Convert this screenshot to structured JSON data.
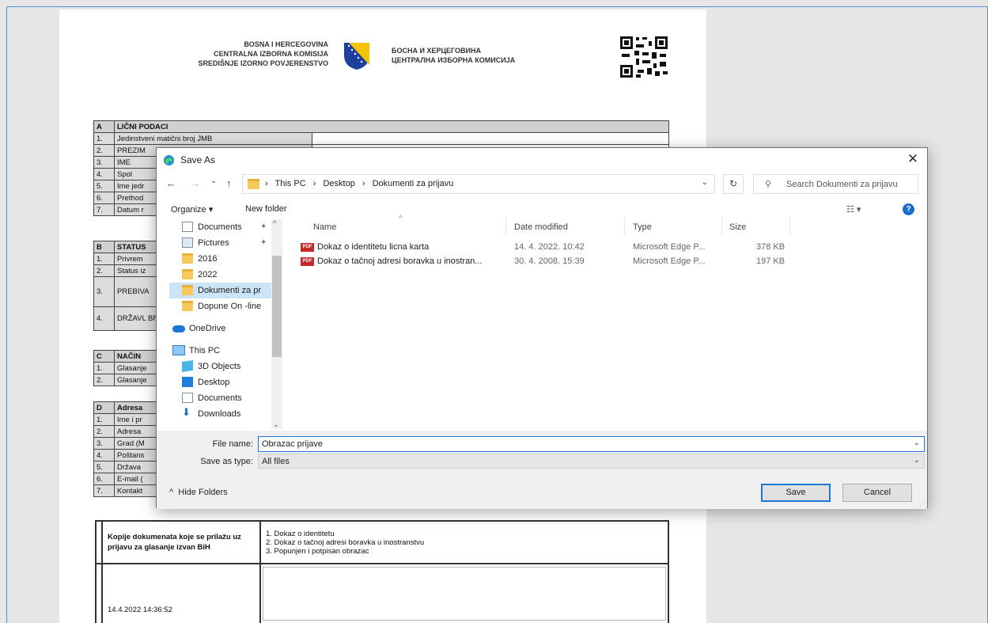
{
  "document": {
    "header_left": [
      "BOSNA I HERCEGOVINA",
      "CENTRALNA IZBORNA KOMISIJA",
      "SREDIŠNJE IZORNO POVJERENSTVO"
    ],
    "header_right": [
      "БОСНА И ХЕРЦЕГОВИНА",
      "ЦЕНТРАЛНА ИЗБОРНА КОМИСИЈА"
    ],
    "section_a": {
      "letter": "A",
      "title": "LIČNI PODACI",
      "rows": [
        {
          "n": "1.",
          "label": "Jedinstveni matični broj JMB"
        },
        {
          "n": "2.",
          "label": "PREZIM"
        },
        {
          "n": "3.",
          "label": "IME"
        },
        {
          "n": "4.",
          "label": "Spol"
        },
        {
          "n": "5.",
          "label": "Ime jedr"
        },
        {
          "n": "6.",
          "label": "Prethod"
        },
        {
          "n": "7.",
          "label": "Datum r"
        }
      ]
    },
    "section_b": {
      "letter": "B",
      "title": "STATUS",
      "rows": [
        {
          "n": "1.",
          "label": "Privrem"
        },
        {
          "n": "2.",
          "label": "Status iz"
        },
        {
          "n": "3.",
          "label": "PREBIVA"
        },
        {
          "n": "4.",
          "label": "DRŽAVL BRČKO"
        }
      ]
    },
    "section_c": {
      "letter": "C",
      "title": "NAČIN",
      "rows": [
        {
          "n": "1.",
          "label": "Glasanje"
        },
        {
          "n": "2.",
          "label": "Glasanje"
        }
      ]
    },
    "section_d": {
      "letter": "D",
      "title": "Adresa",
      "rows": [
        {
          "n": "1.",
          "label": "Ime i pr"
        },
        {
          "n": "2.",
          "label": "Adresa"
        },
        {
          "n": "3.",
          "label": "Grad (M"
        },
        {
          "n": "4.",
          "label": "Poštans"
        },
        {
          "n": "5.",
          "label": "Država"
        },
        {
          "n": "6.",
          "label": "E-mail ("
        },
        {
          "n": "7.",
          "label": "Kontakt"
        }
      ]
    },
    "kopije_label": "Kopije dokumenata koje se prilažu uz prijavu za glasanje izvan BiH",
    "kopije_items": [
      "1.  Dokaz o identitetu",
      "2.  Dokaz o tačnoj adresi boravka u inostranstvu",
      "3.  Popunjen i potpisan obrazac"
    ],
    "timestamp": "14.4.2022 14:36:52"
  },
  "dialog": {
    "title": "Save As",
    "close_glyph": "✕",
    "nav": {
      "back": "←",
      "forward": "→",
      "recent": "⌄",
      "up": "↑"
    },
    "breadcrumbs": [
      "›",
      "This PC",
      "›",
      "Desktop",
      "›",
      "Dokumenti za prijavu"
    ],
    "refresh_glyph": "↻",
    "search_placeholder": "Search Dokumenti za prijavu",
    "toolbar": {
      "organize": "Organize ▾",
      "new_folder": "New folder",
      "view": "☷ ▾",
      "help": "?"
    },
    "sidebar": [
      {
        "label": "Documents",
        "icon": "docs",
        "pinned": true
      },
      {
        "label": "Pictures",
        "icon": "pics",
        "pinned": true
      },
      {
        "label": "2016",
        "icon": "folder"
      },
      {
        "label": "2022",
        "icon": "folder"
      },
      {
        "label": "Dokumenti za pr",
        "icon": "folder",
        "selected": true
      },
      {
        "label": "Dopune On -line",
        "icon": "folder"
      },
      {
        "label": "OneDrive",
        "icon": "cloud"
      },
      {
        "label": "This PC",
        "icon": "pc"
      },
      {
        "label": "3D Objects",
        "icon": "cube"
      },
      {
        "label": "Desktop",
        "icon": "desk"
      },
      {
        "label": "Documents",
        "icon": "docs"
      },
      {
        "label": "Downloads",
        "icon": "dl"
      }
    ],
    "columns": {
      "name": "Name",
      "date": "Date modified",
      "type": "Type",
      "size": "Size"
    },
    "files": [
      {
        "name": "Dokaz o identitetu licna karta",
        "date": "14. 4. 2022. 10:42",
        "type": "Microsoft Edge P...",
        "size": "378 KB"
      },
      {
        "name": "Dokaz o tačnoj adresi boravka u inostran...",
        "date": "30. 4. 2008. 15:39",
        "type": "Microsoft Edge P...",
        "size": "197 KB"
      }
    ],
    "file_name_label": "File name:",
    "file_name_value": "Obrazac prijave",
    "save_type_label": "Save as type:",
    "save_type_value": "All files",
    "hide_folders": "Hide Folders",
    "save_button": "Save",
    "cancel_button": "Cancel",
    "pdf_badge": "PDF"
  }
}
